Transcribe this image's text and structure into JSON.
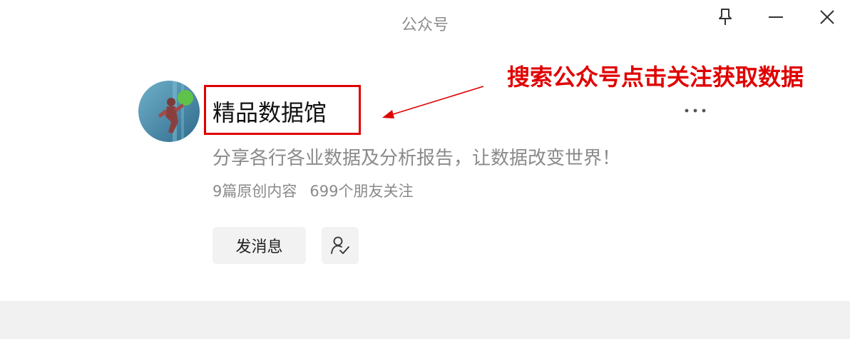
{
  "window": {
    "title": "公众号",
    "pin_icon": "pin-icon",
    "minimize_icon": "minimize-icon",
    "close_icon": "close-icon"
  },
  "account": {
    "name": "精品数据馆",
    "description": "分享各行各业数据及分析报告，让数据改变世界！",
    "original_articles": "9篇原创内容",
    "friends_following": "699个朋友关注",
    "more_icon": "more-dots-icon"
  },
  "actions": {
    "message_label": "发消息",
    "follow_icon": "user-check-icon"
  },
  "annotation": {
    "text": "搜索公众号点击关注获取数据",
    "color": "#e00000"
  },
  "colors": {
    "accent_red": "#e00000",
    "muted_text": "#8a8a8a",
    "button_bg": "#f2f2f2",
    "bottom_strip": "#f1f1f1"
  }
}
